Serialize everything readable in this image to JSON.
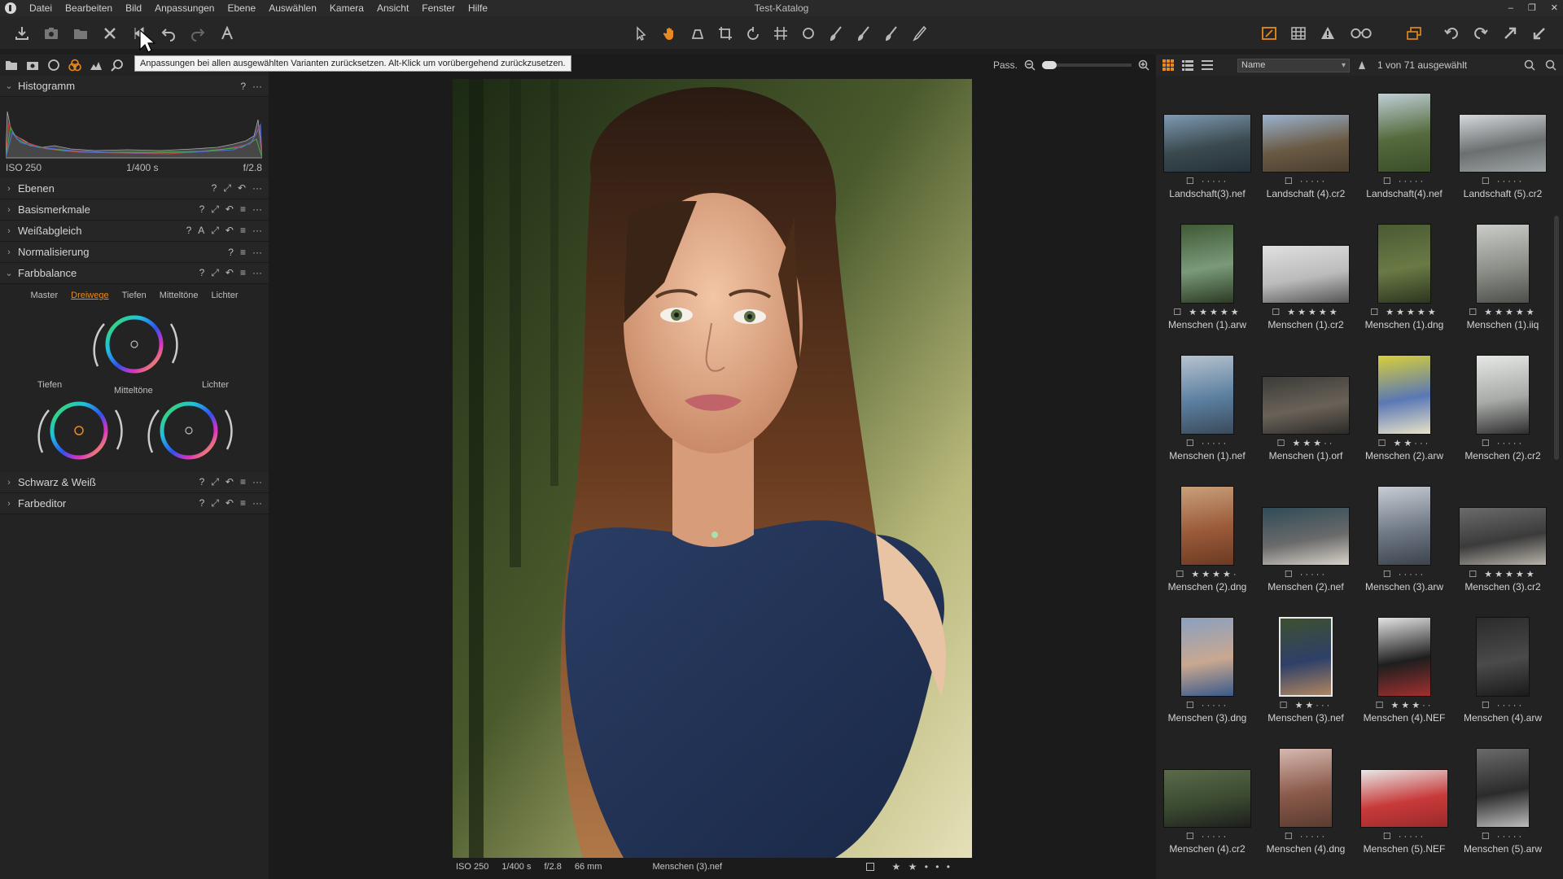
{
  "window": {
    "title": "Test-Katalog",
    "controls": [
      "–",
      "❐",
      "✕"
    ]
  },
  "menu": [
    "Datei",
    "Bearbeiten",
    "Bild",
    "Anpassungen",
    "Ebene",
    "Auswählen",
    "Kamera",
    "Ansicht",
    "Fenster",
    "Hilfe"
  ],
  "tooltip": "Anpassungen bei allen ausgewählten Varianten zurücksetzen. Alt-Klick um vorübergehend zurückzusetzen.",
  "left_panel": {
    "histogram": {
      "title": "Histogramm",
      "iso": "ISO 250",
      "shutter": "1/400 s",
      "aperture": "f/2.8"
    },
    "tools": [
      {
        "title": "Ebenen"
      },
      {
        "title": "Basismerkmale"
      },
      {
        "title": "Weißabgleich"
      },
      {
        "title": "Normalisierung"
      },
      {
        "title": "Farbbalance"
      },
      {
        "title": "Schwarz & Weiß"
      },
      {
        "title": "Farbeditor"
      }
    ],
    "color_balance": {
      "tabs": [
        "Master",
        "Dreiwege",
        "Tiefen",
        "Mitteltöne",
        "Lichter"
      ],
      "active_tab": "Dreiwege",
      "wheel_labels": {
        "shadows": "Tiefen",
        "midtones": "Mitteltöne",
        "highlights": "Lichter"
      }
    },
    "help": "?",
    "auto": "A",
    "more": "···"
  },
  "viewer": {
    "fit_label": "Pass.",
    "info": {
      "iso": "ISO 250",
      "shutter": "1/400 s",
      "aperture": "f/2.8",
      "focal": "66 mm",
      "filename": "Menschen (3).nef"
    },
    "rating": 2
  },
  "browser": {
    "sort_by": "Name",
    "selection": "1 von 71 ausgewählt",
    "thumbs": [
      {
        "name": "Landschaft(3).nef",
        "rating": 0,
        "orient": "land",
        "colors": [
          "#7f9ab3",
          "#3b4a4f",
          "#25313a"
        ]
      },
      {
        "name": "Landschaft (4).cr2",
        "rating": 0,
        "orient": "land",
        "colors": [
          "#9ab3cf",
          "#6a5a44",
          "#4a3e30"
        ]
      },
      {
        "name": "Landschaft(4).nef",
        "rating": 0,
        "orient": "port",
        "colors": [
          "#bfcfd6",
          "#556b3d",
          "#3a4d2a"
        ]
      },
      {
        "name": "Landschaft (5).cr2",
        "rating": 0,
        "orient": "land",
        "colors": [
          "#d5d9dc",
          "#6b6f70",
          "#9ea4a6"
        ]
      },
      {
        "name": "Menschen (1).arw",
        "rating": 5,
        "orient": "port",
        "colors": [
          "#3f5a34",
          "#7a9a7a",
          "#2c3b24"
        ]
      },
      {
        "name": "Menschen (1).cr2",
        "rating": 5,
        "orient": "land",
        "colors": [
          "#e0e0e0",
          "#bbbbbb",
          "#555555"
        ]
      },
      {
        "name": "Menschen (1).dng",
        "rating": 5,
        "orient": "port",
        "colors": [
          "#4a5a33",
          "#6a7a45",
          "#2d3620"
        ]
      },
      {
        "name": "Menschen (1).iiq",
        "rating": 5,
        "orient": "port",
        "colors": [
          "#c9ccc8",
          "#8c8f88",
          "#4d4f4a"
        ]
      },
      {
        "name": "Menschen (1).nef",
        "rating": 0,
        "orient": "port",
        "colors": [
          "#b7c3cf",
          "#5b7fa0",
          "#3b4a5a"
        ]
      },
      {
        "name": "Menschen (1).orf",
        "rating": 3,
        "orient": "land",
        "colors": [
          "#3b3b38",
          "#6a6258",
          "#2b2a28"
        ]
      },
      {
        "name": "Menschen (2).arw",
        "rating": 2,
        "orient": "port",
        "colors": [
          "#d8cf3a",
          "#5a78b5",
          "#e8e2c8"
        ]
      },
      {
        "name": "Menschen (2).cr2",
        "rating": 0,
        "orient": "port",
        "colors": [
          "#e6e8e6",
          "#a7aaa7",
          "#2e2e2e"
        ]
      },
      {
        "name": "Menschen (2).dng",
        "rating": 4,
        "orient": "port",
        "colors": [
          "#c9a07a",
          "#9a5a3a",
          "#6b3a22"
        ]
      },
      {
        "name": "Menschen (2).nef",
        "rating": 0,
        "orient": "land",
        "colors": [
          "#2f4b57",
          "#6a6a6a",
          "#d8d3cb"
        ]
      },
      {
        "name": "Menschen (3).arw",
        "rating": 0,
        "orient": "port",
        "colors": [
          "#c7cdd4",
          "#6f7885",
          "#3c434d"
        ]
      },
      {
        "name": "Menschen (3).cr2",
        "rating": 5,
        "orient": "land",
        "colors": [
          "#6b6b6b",
          "#3b3b3b",
          "#b8b3aa"
        ]
      },
      {
        "name": "Menschen (3).dng",
        "rating": 0,
        "orient": "port",
        "colors": [
          "#8aa0bf",
          "#c9a890",
          "#3a5a8a"
        ]
      },
      {
        "name": "Menschen (3).nef",
        "rating": 2,
        "orient": "port",
        "colors": [
          "#3e5030",
          "#2e4068",
          "#b08560"
        ],
        "selected": true
      },
      {
        "name": "Menschen (4).NEF",
        "rating": 3,
        "orient": "port",
        "colors": [
          "#e3e3e3",
          "#1e1e1e",
          "#a03030"
        ]
      },
      {
        "name": "Menschen (4).arw",
        "rating": 0,
        "orient": "port",
        "colors": [
          "#2b2b2b",
          "#4a4a4a",
          "#1a1a1a"
        ]
      },
      {
        "name": "Menschen (4).cr2",
        "rating": 0,
        "orient": "land",
        "colors": [
          "#5a6a4a",
          "#3b4a30",
          "#1e1e1e"
        ]
      },
      {
        "name": "Menschen (4).dng",
        "rating": 0,
        "orient": "port",
        "colors": [
          "#d6b8b0",
          "#8a5a4a",
          "#5a3b30"
        ]
      },
      {
        "name": "Menschen (5).NEF",
        "rating": 0,
        "orient": "land",
        "colors": [
          "#e8e8e8",
          "#c83a3a",
          "#9a2a2a"
        ]
      },
      {
        "name": "Menschen (5).arw",
        "rating": 0,
        "orient": "port",
        "colors": [
          "#6a6a6a",
          "#2b2b2b",
          "#bcbcbc"
        ]
      }
    ]
  },
  "colors": {
    "accent": "#e88a1f",
    "panel": "#232323",
    "bg": "#1b1b1b"
  }
}
